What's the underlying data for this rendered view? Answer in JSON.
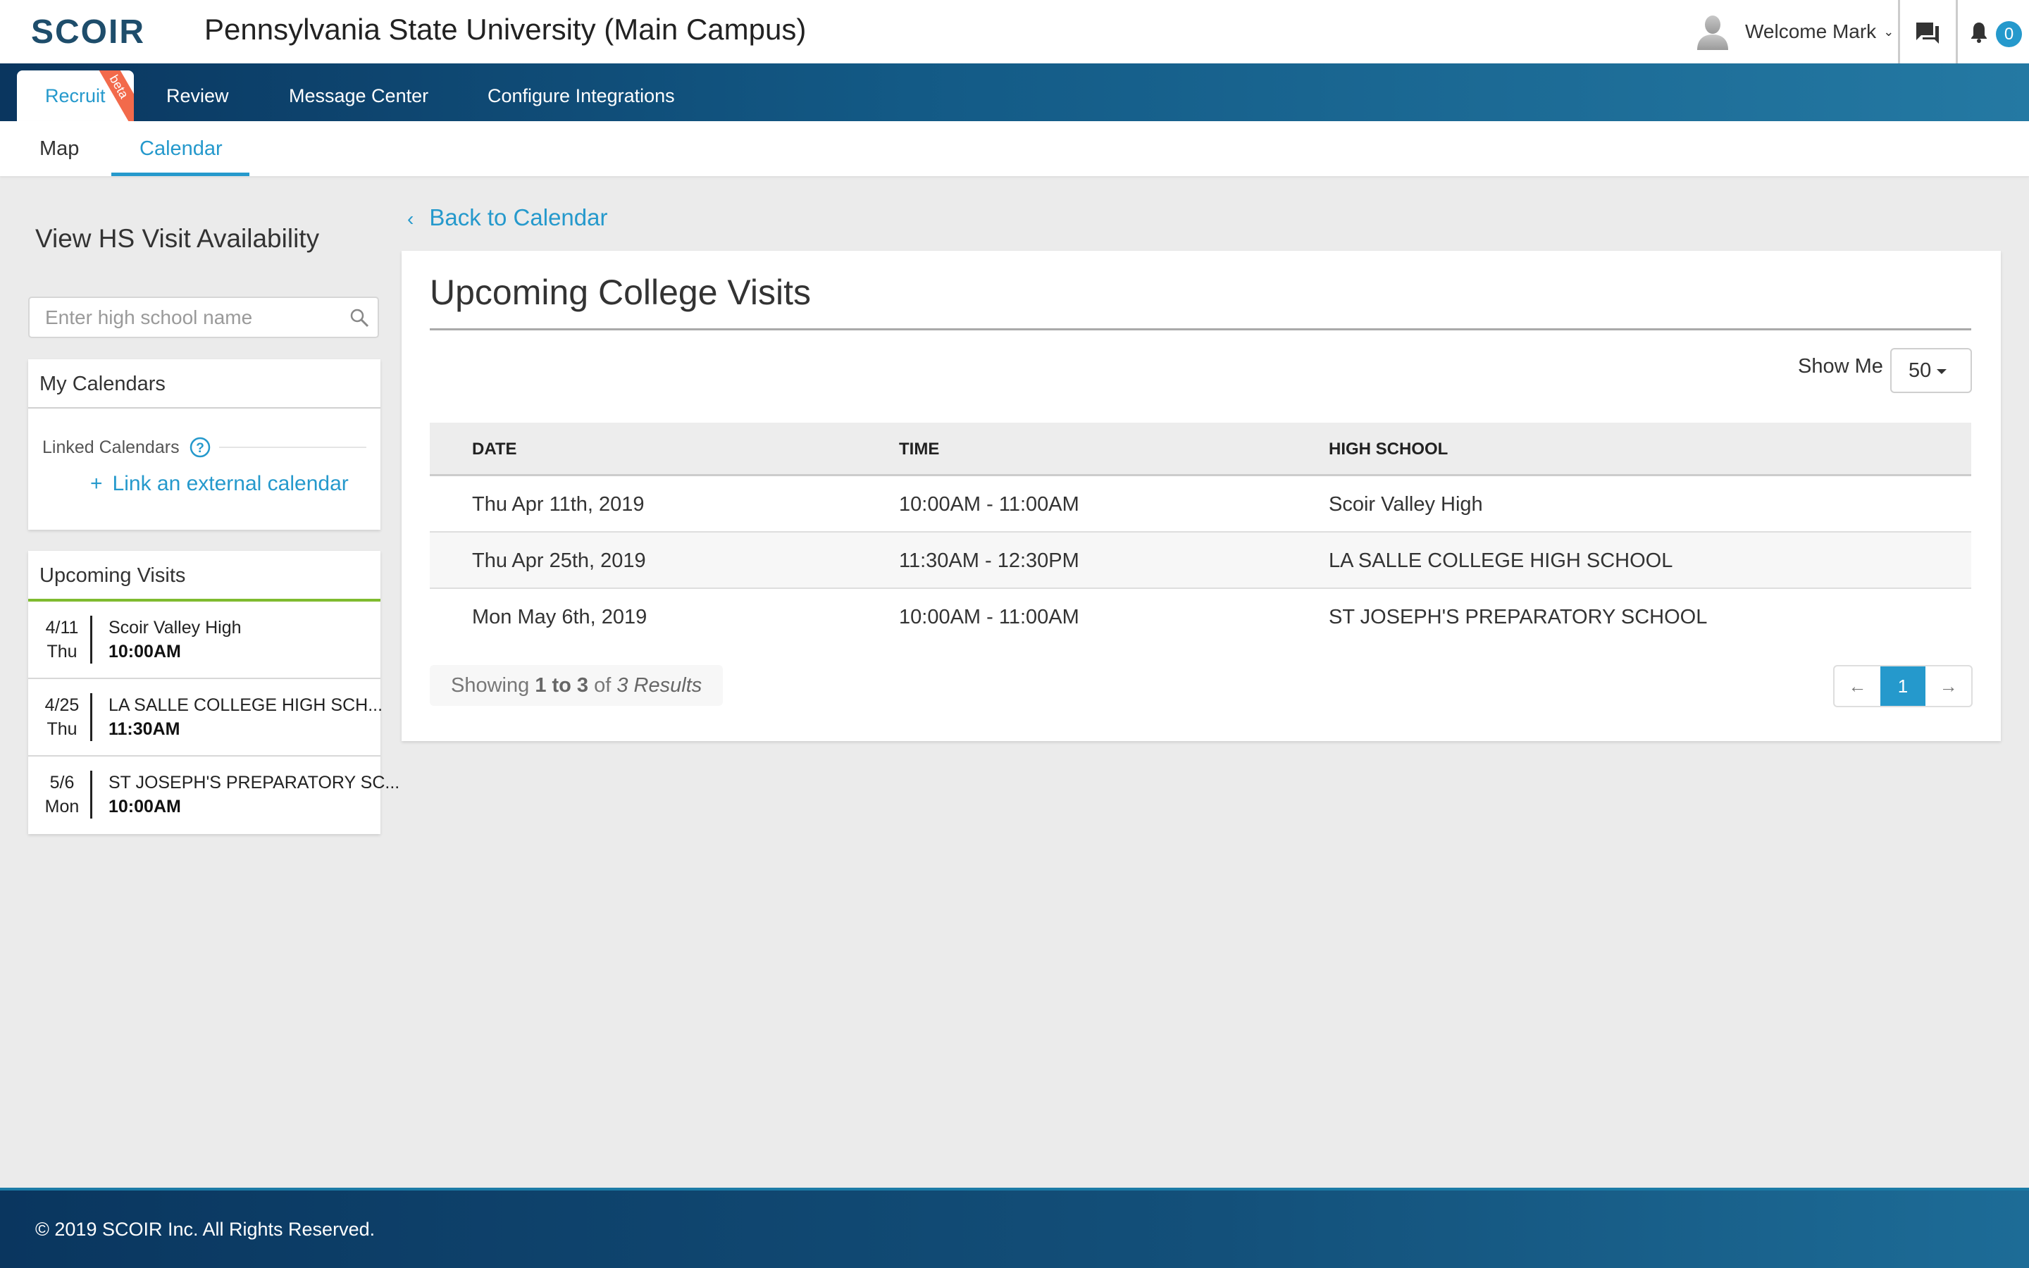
{
  "header": {
    "logo": "SCOIR",
    "institution": "Pennsylvania State University (Main Campus)",
    "welcome": "Welcome Mark",
    "notification_count": "0"
  },
  "nav": {
    "tabs": [
      {
        "label": "Recruit",
        "badge": "beta",
        "active": true
      },
      {
        "label": "Review"
      },
      {
        "label": "Message Center"
      },
      {
        "label": "Configure Integrations"
      }
    ]
  },
  "subnav": {
    "tabs": [
      {
        "label": "Map"
      },
      {
        "label": "Calendar",
        "active": true
      }
    ]
  },
  "sidebar": {
    "title": "View HS Visit Availability",
    "search_placeholder": "Enter high school name",
    "search_value": "",
    "my_calendars": {
      "title": "My Calendars",
      "linked_label": "Linked Calendars",
      "link_action": "Link an external calendar"
    },
    "upcoming": {
      "title": "Upcoming Visits",
      "items": [
        {
          "date": "4/11",
          "day": "Thu",
          "school": "Scoir Valley High",
          "time": "10:00AM"
        },
        {
          "date": "4/25",
          "day": "Thu",
          "school": "LA SALLE COLLEGE HIGH SCH...",
          "time": "11:30AM"
        },
        {
          "date": "5/6",
          "day": "Mon",
          "school": "ST JOSEPH'S PREPARATORY SC...",
          "time": "10:00AM"
        }
      ]
    }
  },
  "main": {
    "back_label": "Back to Calendar",
    "title": "Upcoming College Visits",
    "show_me_label": "Show Me",
    "show_me_value": "50",
    "table": {
      "columns": [
        "DATE",
        "TIME",
        "HIGH SCHOOL"
      ],
      "rows": [
        [
          "Thu Apr 11th, 2019",
          "10:00AM - 11:00AM",
          "Scoir Valley High"
        ],
        [
          "Thu Apr 25th, 2019",
          "11:30AM - 12:30PM",
          "LA SALLE COLLEGE HIGH SCHOOL"
        ],
        [
          "Mon May 6th, 2019",
          "10:00AM - 11:00AM",
          "ST JOSEPH'S PREPARATORY SCHOOL"
        ]
      ]
    },
    "showing": {
      "prefix": "Showing",
      "range": "1 to 3",
      "of": "of",
      "total": "3 Results"
    },
    "pagination": {
      "current_page": "1",
      "prev_icon": "←",
      "next_icon": "→"
    }
  },
  "footer": {
    "copyright": "© 2019 SCOIR Inc. All Rights Reserved."
  },
  "colors": {
    "accent": "#2599cc",
    "nav_dark": "#0a365f",
    "beta_ribbon": "#f26a4b",
    "upcoming_accent": "#7fbb2f"
  }
}
